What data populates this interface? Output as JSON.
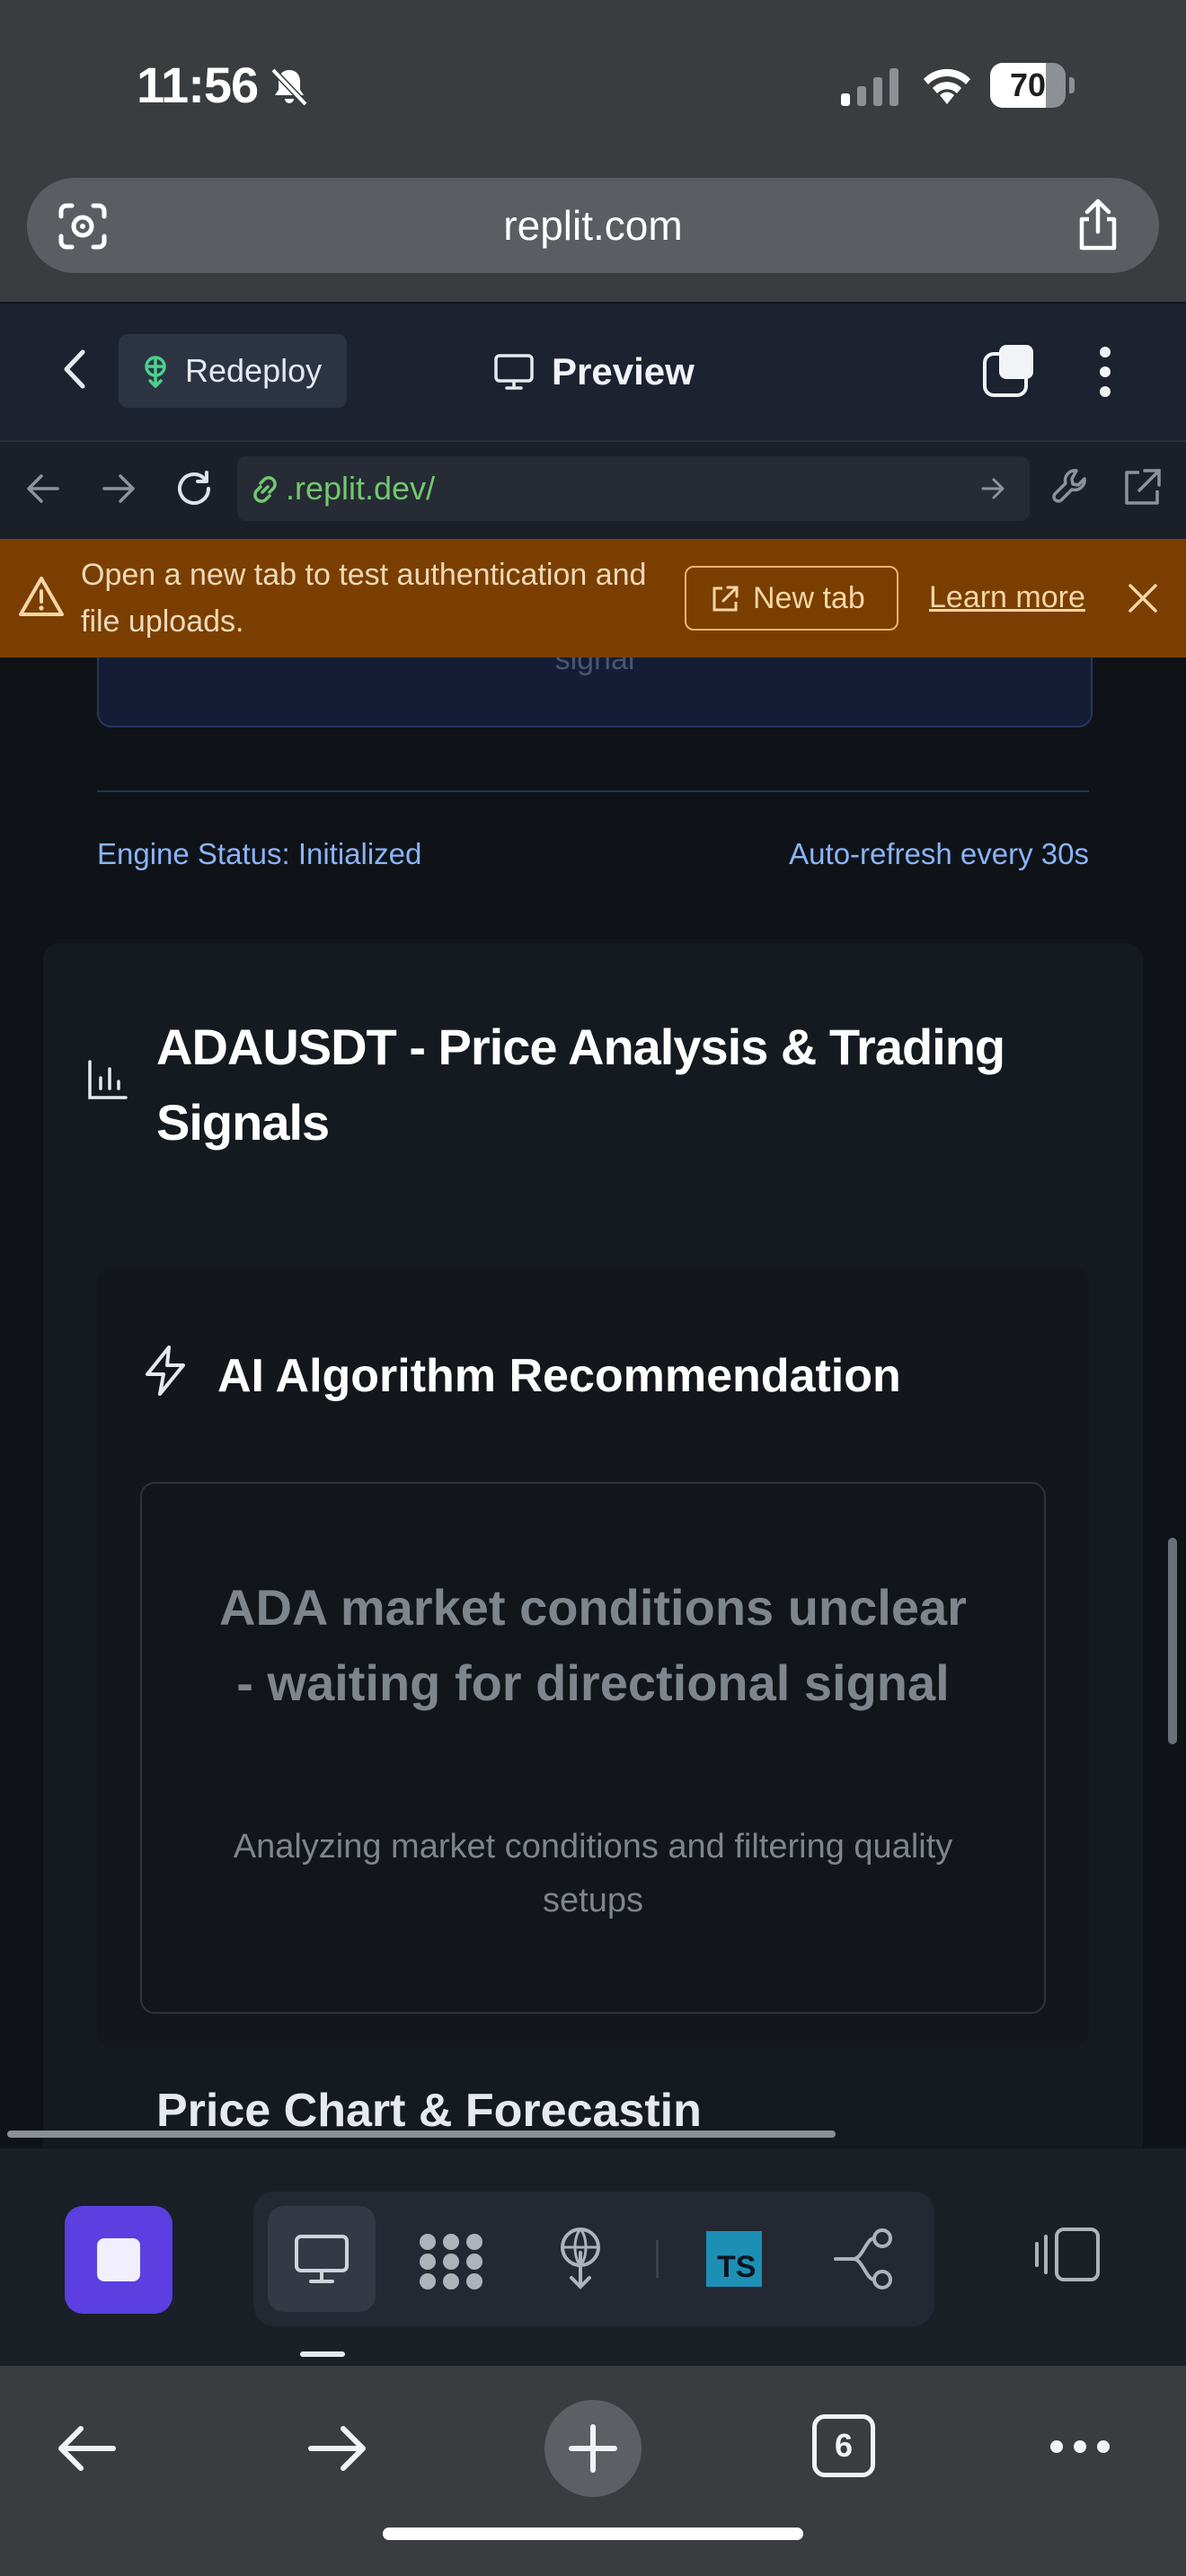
{
  "status_bar": {
    "time": "11:56",
    "battery": "70"
  },
  "browser": {
    "url": "replit.com"
  },
  "replit_header": {
    "redeploy_label": "Redeploy",
    "preview_label": "Preview"
  },
  "webview": {
    "address": ".replit.dev/"
  },
  "banner": {
    "message": "Open a new tab to test authentication and file uploads.",
    "new_tab_label": "New tab",
    "learn_more_label": "Learn more"
  },
  "page": {
    "partial_text": "signal",
    "engine_status": "Engine Status: Initialized",
    "auto_refresh": "Auto-refresh every 30s",
    "section_title": "ADAUSDT - Price Analysis & Trading Signals",
    "recommendation_title": "AI Algorithm Recommendation",
    "recommendation_main": "ADA market conditions unclear - waiting for directional signal",
    "recommendation_sub": "Analyzing market conditions and filtering quality setups",
    "next_section_partial": "Price Chart & Forecastin"
  },
  "bottom_toolbar": {
    "ts_label": "TS"
  },
  "browser_bottom": {
    "tab_count": "6"
  },
  "colors": {
    "accent_purple": "#5b3fe0",
    "banner_bg": "#7a3f00",
    "link_green": "#72c86e",
    "status_blue": "#8ab4f8"
  }
}
